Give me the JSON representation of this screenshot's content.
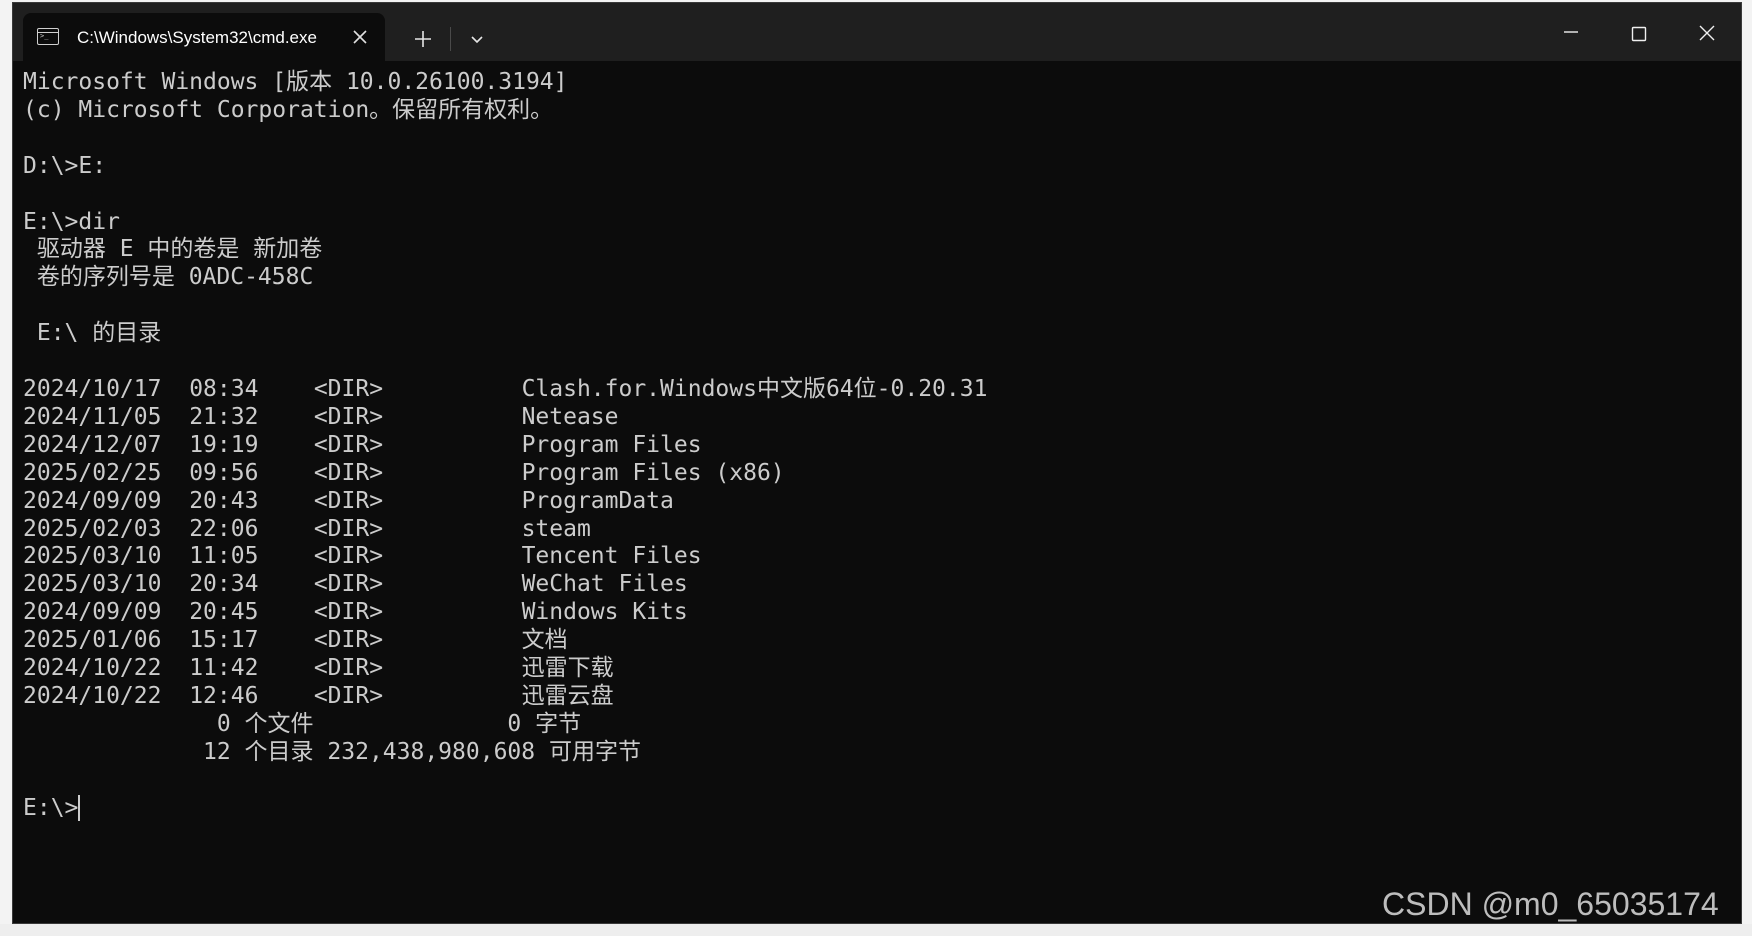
{
  "window": {
    "tab_title": "C:\\Windows\\System32\\cmd.exe",
    "tab_close_icon": "close-icon",
    "new_tab_icon": "plus-icon",
    "dropdown_icon": "chevron-down-icon",
    "minimize_icon": "minimize-icon",
    "maximize_icon": "maximize-icon",
    "close_icon": "close-icon"
  },
  "console": {
    "header": [
      "Microsoft Windows [版本 10.0.26100.3194]",
      "(c) Microsoft Corporation。保留所有权利。"
    ],
    "commands": [
      "D:\\>E:",
      "E:\\>dir"
    ],
    "volume_info": [
      " 驱动器 E 中的卷是 新加卷",
      " 卷的序列号是 0ADC-458C"
    ],
    "directory_heading": " E:\\ 的目录",
    "entries": [
      {
        "date": "2024/10/17",
        "time": "08:34",
        "type": "<DIR>",
        "name": "Clash.for.Windows中文版64位-0.20.31"
      },
      {
        "date": "2024/11/05",
        "time": "21:32",
        "type": "<DIR>",
        "name": "Netease"
      },
      {
        "date": "2024/12/07",
        "time": "19:19",
        "type": "<DIR>",
        "name": "Program Files"
      },
      {
        "date": "2025/02/25",
        "time": "09:56",
        "type": "<DIR>",
        "name": "Program Files (x86)"
      },
      {
        "date": "2024/09/09",
        "time": "20:43",
        "type": "<DIR>",
        "name": "ProgramData"
      },
      {
        "date": "2025/02/03",
        "time": "22:06",
        "type": "<DIR>",
        "name": "steam"
      },
      {
        "date": "2025/03/10",
        "time": "11:05",
        "type": "<DIR>",
        "name": "Tencent Files"
      },
      {
        "date": "2025/03/10",
        "time": "20:34",
        "type": "<DIR>",
        "name": "WeChat Files"
      },
      {
        "date": "2024/09/09",
        "time": "20:45",
        "type": "<DIR>",
        "name": "Windows Kits"
      },
      {
        "date": "2025/01/06",
        "time": "15:17",
        "type": "<DIR>",
        "name": "文档"
      },
      {
        "date": "2024/10/22",
        "time": "11:42",
        "type": "<DIR>",
        "name": "迅雷下载"
      },
      {
        "date": "2024/10/22",
        "time": "12:46",
        "type": "<DIR>",
        "name": "迅雷云盘"
      }
    ],
    "summary_files": "              0 个文件              0 字节",
    "summary_dirs": "             12 个目录 232,438,980,608 可用字节",
    "prompt": "E:\\>"
  },
  "watermark": "CSDN @m0_65035174",
  "colors": {
    "console_bg": "#0c0c0c",
    "console_text": "#cccccc",
    "titlebar_bg": "#1f1f1f"
  }
}
